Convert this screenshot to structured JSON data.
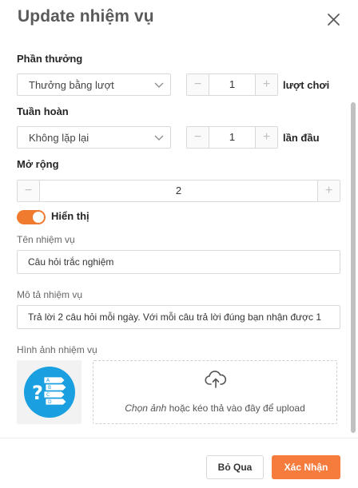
{
  "modal": {
    "title": "Update nhiệm vụ"
  },
  "reward": {
    "label": "Phần thưởng",
    "select_value": "Thưởng bằng lượt",
    "stepper_value": "1",
    "unit": "lượt chơi"
  },
  "recurrence": {
    "label": "Tuần hoàn",
    "select_value": "Không lặp lại",
    "stepper_value": "1",
    "unit": "lần đầu"
  },
  "expand": {
    "label": "Mở rộng",
    "stepper_value": "2"
  },
  "display_toggle": {
    "label": "Hiển thị",
    "on": true
  },
  "task_name": {
    "label": "Tên nhiệm vụ",
    "value": "Câu hỏi trắc nghiệm"
  },
  "task_desc": {
    "label": "Mô tả nhiệm vụ",
    "value": "Trả lời 2 câu hỏi mỗi ngày. Với mỗi câu trả lời đúng bạn nhận được 1"
  },
  "task_image": {
    "label": "Hình ảnh nhiệm vụ",
    "thumbnail_icon": "quiz-icon",
    "upload_link": "Chọn ảnh",
    "upload_text": " hoặc kéo thả vào đây để upload"
  },
  "footer": {
    "cancel_label": "Bỏ Qua",
    "confirm_label": "Xác Nhận"
  },
  "colors": {
    "accent": "#f57c3d",
    "toggle_on": "#f07a2d",
    "quiz_icon_bg": "#1a9fe0"
  }
}
